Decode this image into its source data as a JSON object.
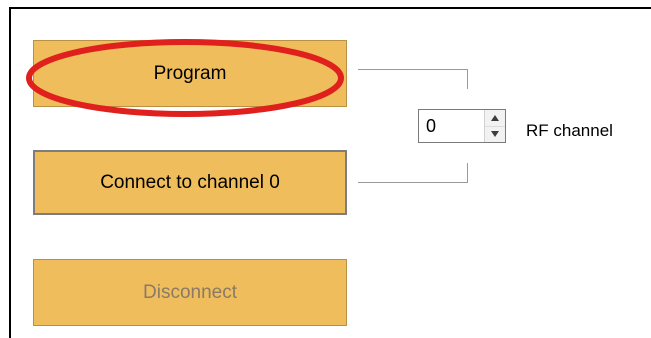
{
  "buttons": {
    "program_label": "Program",
    "connect_label": "Connect to channel 0",
    "disconnect_label": "Disconnect"
  },
  "channel_spinner": {
    "value": "0",
    "label": "RF channel"
  },
  "highlight": {
    "color": "#e0201c"
  },
  "colors": {
    "button_fill": "#efbd5c",
    "disabled_text": "#8a7a66"
  }
}
